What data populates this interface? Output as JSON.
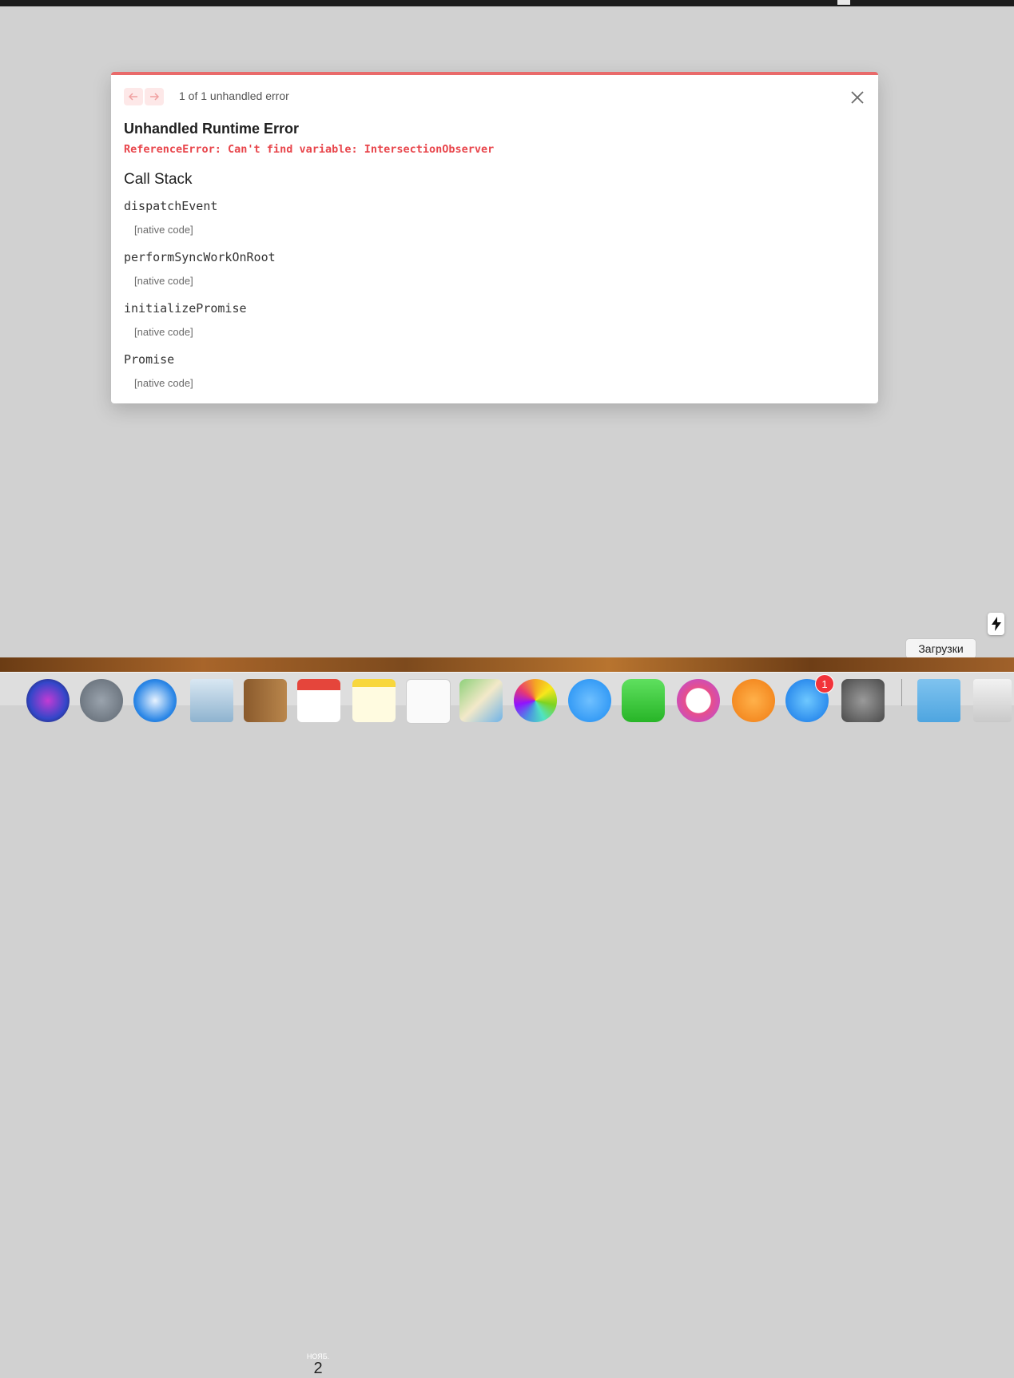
{
  "overlay": {
    "counter": "1 of 1 unhandled error",
    "title": "Unhandled Runtime Error",
    "message": "ReferenceError: Can't find variable: IntersectionObserver",
    "stack_title": "Call Stack",
    "frames": [
      {
        "fn": "dispatchEvent",
        "src": "[native code]"
      },
      {
        "fn": "performSyncWorkOnRoot",
        "src": "[native code]"
      },
      {
        "fn": "initializePromise",
        "src": "[native code]"
      },
      {
        "fn": "Promise",
        "src": "[native code]"
      }
    ],
    "accent_color": "#e96a6a",
    "error_color": "#e8454b"
  },
  "dock": {
    "tooltip": "Загрузки",
    "calendar_month": "НОЯБ.",
    "calendar_day": "2",
    "appstore_badge": "1",
    "icons": [
      "siri-icon",
      "launchpad-icon",
      "safari-icon",
      "mail-icon",
      "contacts-icon",
      "calendar-icon",
      "notes-icon",
      "reminders-icon",
      "maps-icon",
      "photos-icon",
      "messages-icon",
      "facetime-icon",
      "itunes-icon",
      "books-icon",
      "appstore-icon",
      "system-preferences-icon",
      "downloads-folder-icon",
      "trash-icon"
    ]
  }
}
